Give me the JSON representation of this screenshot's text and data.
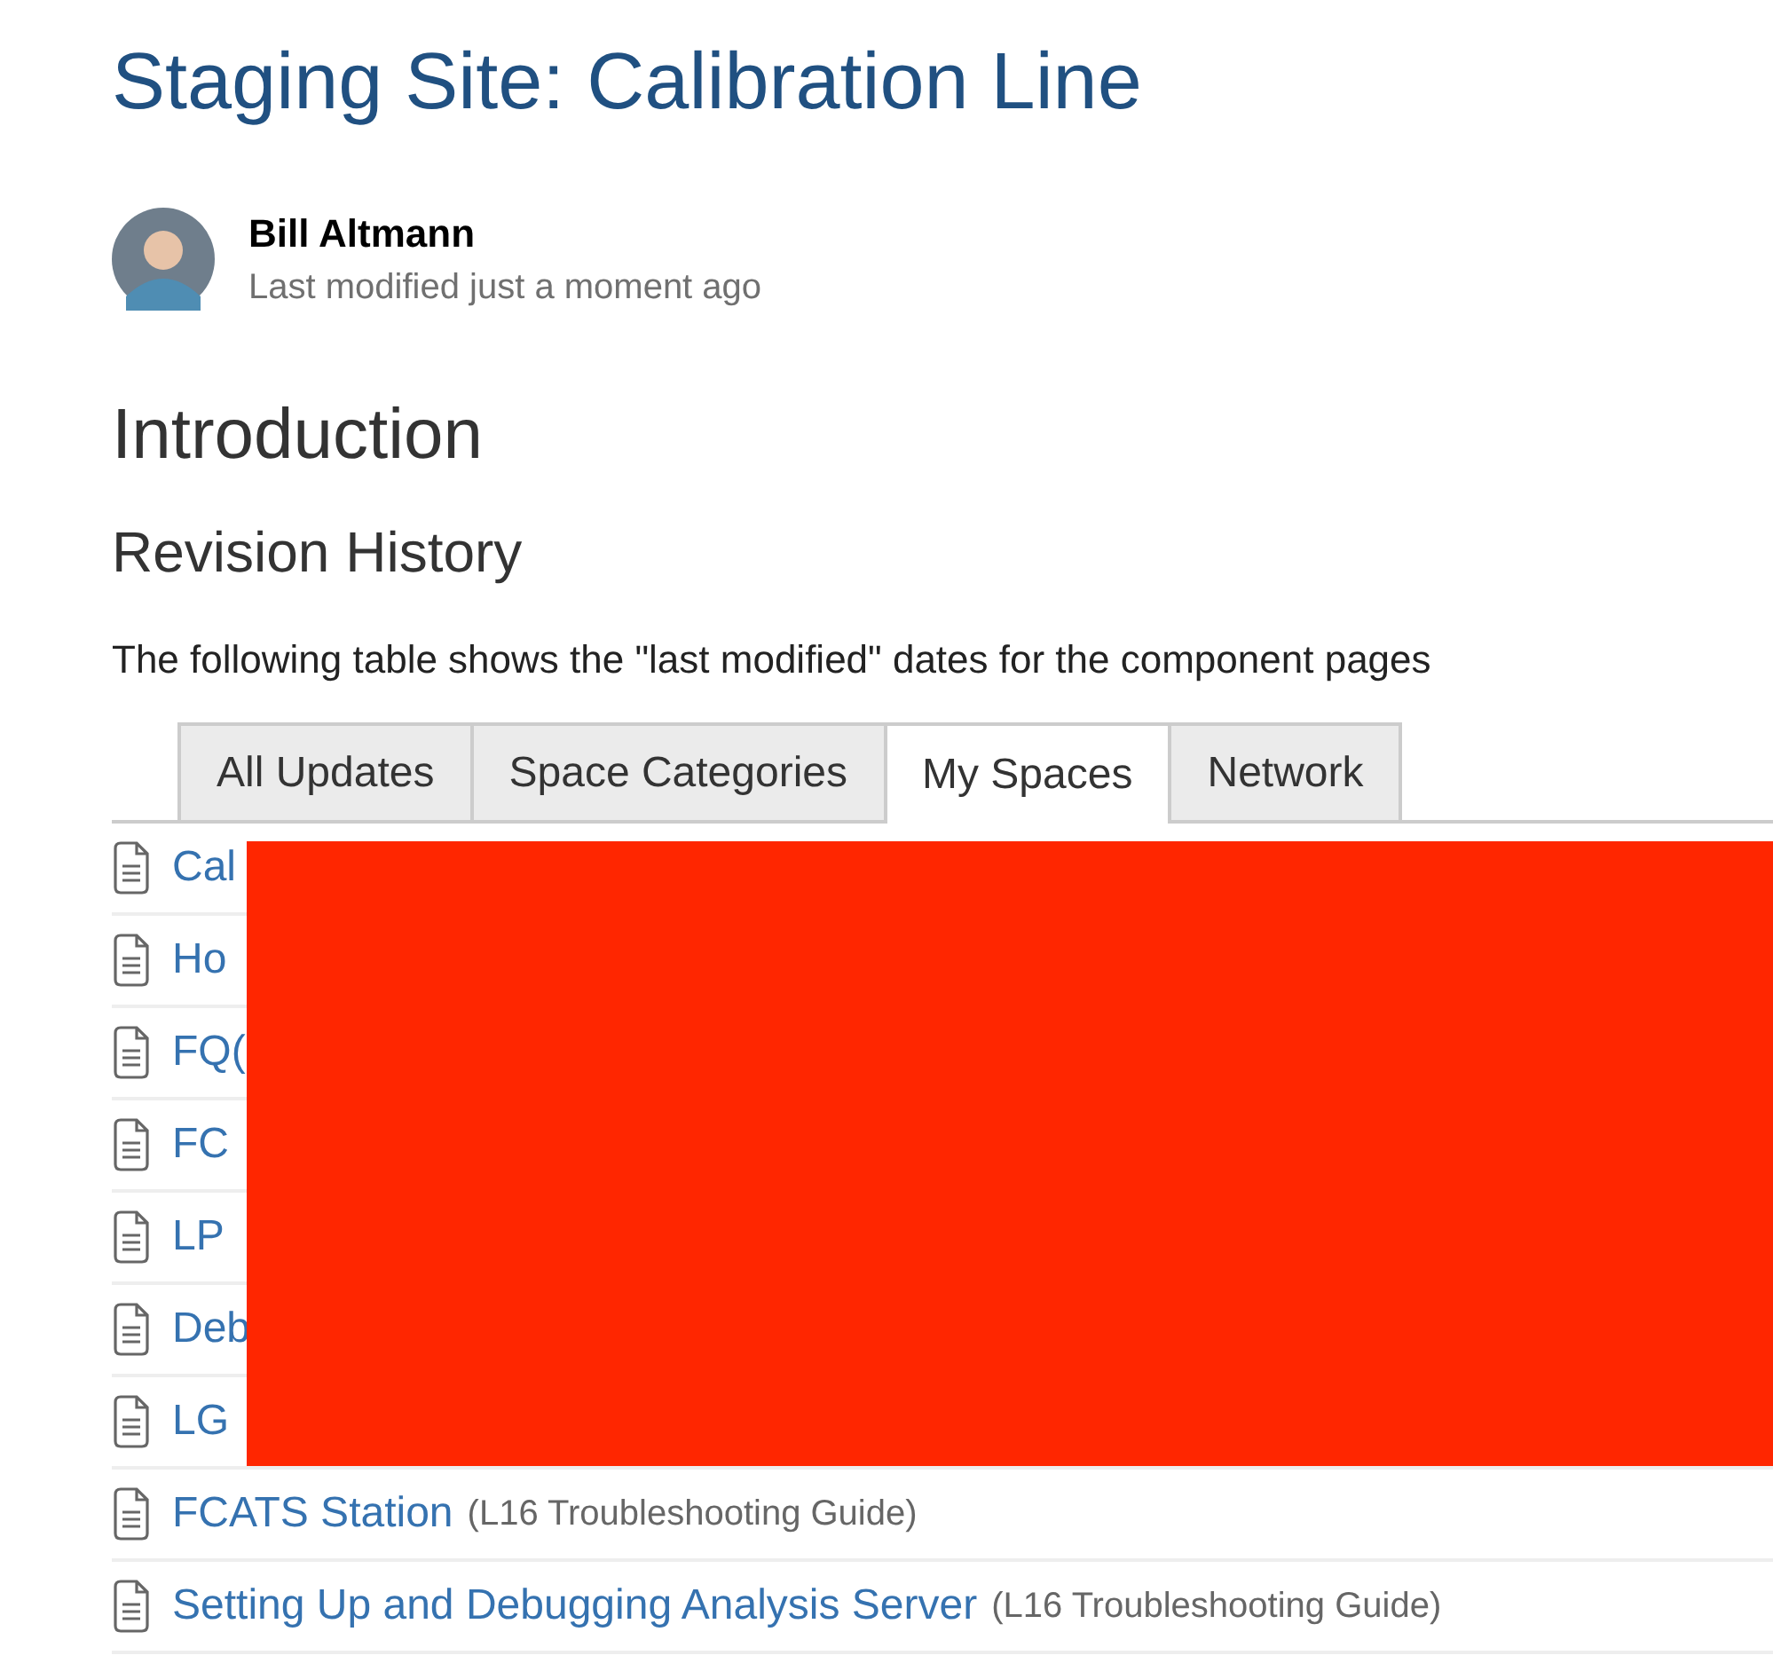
{
  "page": {
    "title": "Staging Site: Calibration Line"
  },
  "author": {
    "name": "Bill Altmann",
    "meta": "Last modified just a moment ago"
  },
  "heading": "Introduction",
  "subheading": "Revision History",
  "paragraph": "The following table shows the \"last modified\" dates for the component pages",
  "tabs": [
    {
      "label": "All Updates",
      "selected": false
    },
    {
      "label": "Space Categories",
      "selected": false
    },
    {
      "label": "My Spaces",
      "selected": true
    },
    {
      "label": "Network",
      "selected": false
    }
  ],
  "pages": [
    {
      "title": "Cal"
    },
    {
      "title": "Ho"
    },
    {
      "title": "FQ("
    },
    {
      "title": "FC"
    },
    {
      "title": "LP"
    },
    {
      "title": "Deb"
    },
    {
      "title": "LG"
    },
    {
      "title": "FCATS Station",
      "space": "(L16 Troubleshooting Guide)"
    },
    {
      "title": "Setting Up and Debugging Analysis Server",
      "space": "(L16 Troubleshooting Guide)"
    }
  ],
  "redaction": {
    "kind": "block"
  }
}
